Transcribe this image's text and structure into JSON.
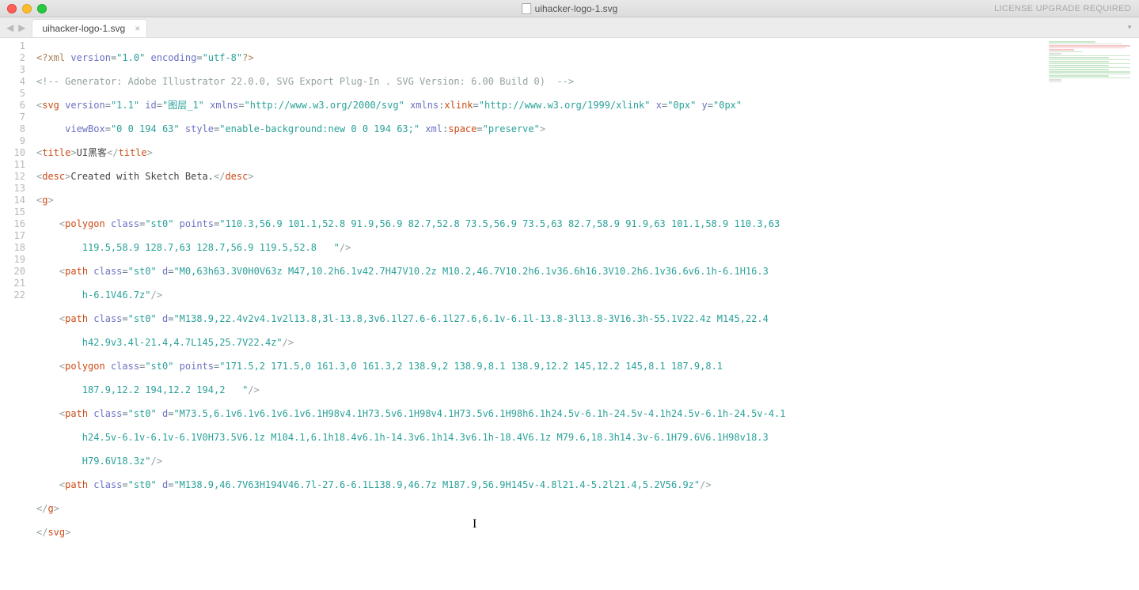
{
  "window": {
    "title": "uihacker-logo-1.svg",
    "license_message": "LICENSE UPGRADE REQUIRED"
  },
  "tabs": [
    {
      "label": "uihacker-logo-1.svg",
      "active": true
    }
  ],
  "nav": {
    "back": "◀",
    "forward": "▶",
    "dropdown": "▼"
  },
  "line_numbers": [
    "1",
    "2",
    "3",
    "4",
    "5",
    "6",
    "7",
    "8",
    "9",
    "10",
    "11",
    "12",
    "13",
    "14",
    "15",
    "16",
    "17",
    "18",
    "19",
    "20",
    "21",
    "22"
  ],
  "code": {
    "l1": {
      "xml_open": "<?",
      "xml": "xml",
      "version_attr": " version",
      "version_val": "\"1.0\"",
      "enc_attr": " encoding",
      "enc_val": "\"utf-8\"",
      "xml_close": "?>"
    },
    "l2": {
      "comment": "<!-- Generator: Adobe Illustrator 22.0.0, SVG Export Plug-In . SVG Version: 6.00 Build 0)  -->"
    },
    "l3": {
      "open": "<",
      "tag": "svg",
      "a1": " version",
      "v1": "\"1.1\"",
      "a2": " id",
      "v2": "\"图层_1\"",
      "a3": " xmlns",
      "v3": "\"http://www.w3.org/2000/svg\"",
      "a4_pre": " xmlns",
      "a4_colon": ":",
      "a4_suf": "xlink",
      "v4": "\"http://www.w3.org/1999/xlink\"",
      "a5": " x",
      "v5": "\"0px\"",
      "a6": " y",
      "v6": "\"0px\""
    },
    "l4": {
      "a1": "viewBox",
      "v1": "\"0 0 194 63\"",
      "a2": " style",
      "v2": "\"enable-background:new 0 0 194 63;\"",
      "a3_pre": " xml",
      "a3_colon": ":",
      "a3_suf": "space",
      "v3": "\"preserve\"",
      "close": ">"
    },
    "l5": {
      "open": "<",
      "tag": "title",
      "close1": ">",
      "text": "UI黑客",
      "open2": "</",
      "tag2": "title",
      "close2": ">"
    },
    "l6": {
      "open": "<",
      "tag": "desc",
      "close1": ">",
      "text": "Created with Sketch Beta.",
      "open2": "</",
      "tag2": "desc",
      "close2": ">"
    },
    "l7": {
      "open": "<",
      "tag": "g",
      "close": ">"
    },
    "l8": {
      "open": "<",
      "tag": "polygon",
      "a1": " class",
      "v1": "\"st0\"",
      "a2": " points",
      "v2": "\"110.3,56.9 101.1,52.8 91.9,56.9 82.7,52.8 73.5,56.9 73.5,63 82.7,58.9 91.9,63 101.1,58.9 110.3,63 "
    },
    "l9": {
      "cont": "119.5,58.9 128.7,63 128.7,56.9 119.5,52.8   \"",
      "close": "/>"
    },
    "l10": {
      "open": "<",
      "tag": "path",
      "a1": " class",
      "v1": "\"st0\"",
      "a2": " d",
      "v2": "\"M0,63h63.3V0H0V63z M47,10.2h6.1v42.7H47V10.2z M10.2,46.7V10.2h6.1v36.6h16.3V10.2h6.1v36.6v6.1h-6.1H16.3"
    },
    "l11": {
      "cont": "h-6.1V46.7z\"",
      "close": "/>"
    },
    "l12": {
      "open": "<",
      "tag": "path",
      "a1": " class",
      "v1": "\"st0\"",
      "a2": " d",
      "v2": "\"M138.9,22.4v2v4.1v2l13.8,3l-13.8,3v6.1l27.6-6.1l27.6,6.1v-6.1l-13.8-3l13.8-3V16.3h-55.1V22.4z M145,22.4"
    },
    "l13": {
      "cont": "h42.9v3.4l-21.4,4.7L145,25.7V22.4z\"",
      "close": "/>"
    },
    "l14": {
      "open": "<",
      "tag": "polygon",
      "a1": " class",
      "v1": "\"st0\"",
      "a2": " points",
      "v2": "\"171.5,2 171.5,0 161.3,0 161.3,2 138.9,2 138.9,8.1 138.9,12.2 145,12.2 145,8.1 187.9,8.1 "
    },
    "l15": {
      "cont": "187.9,12.2 194,12.2 194,2   \"",
      "close": "/>"
    },
    "l16": {
      "open": "<",
      "tag": "path",
      "a1": " class",
      "v1": "\"st0\"",
      "a2": " d",
      "v2": "\"M73.5,6.1v6.1v6.1v6.1v6.1H98v4.1H73.5v6.1H98v4.1H73.5v6.1H98h6.1h24.5v-6.1h-24.5v-4.1h24.5v-6.1h-24.5v-4.1"
    },
    "l17": {
      "cont": "h24.5v-6.1v-6.1v-6.1V0H73.5V6.1z M104.1,6.1h18.4v6.1h-14.3v6.1h14.3v6.1h-18.4V6.1z M79.6,18.3h14.3v-6.1H79.6V6.1H98v18.3"
    },
    "l18": {
      "cont": "H79.6V18.3z\"",
      "close": "/>"
    },
    "l19": {
      "open": "<",
      "tag": "path",
      "a1": " class",
      "v1": "\"st0\"",
      "a2": " d",
      "v2": "\"M138.9,46.7V63H194V46.7l-27.6-6.1L138.9,46.7z M187.9,56.9H145v-4.8l21.4-5.2l21.4,5.2V56.9z\"",
      "close": "/>"
    },
    "l20": {
      "open": "</",
      "tag": "g",
      "close": ">"
    },
    "l21": {
      "open": "</",
      "tag": "svg",
      "close": ">"
    }
  }
}
